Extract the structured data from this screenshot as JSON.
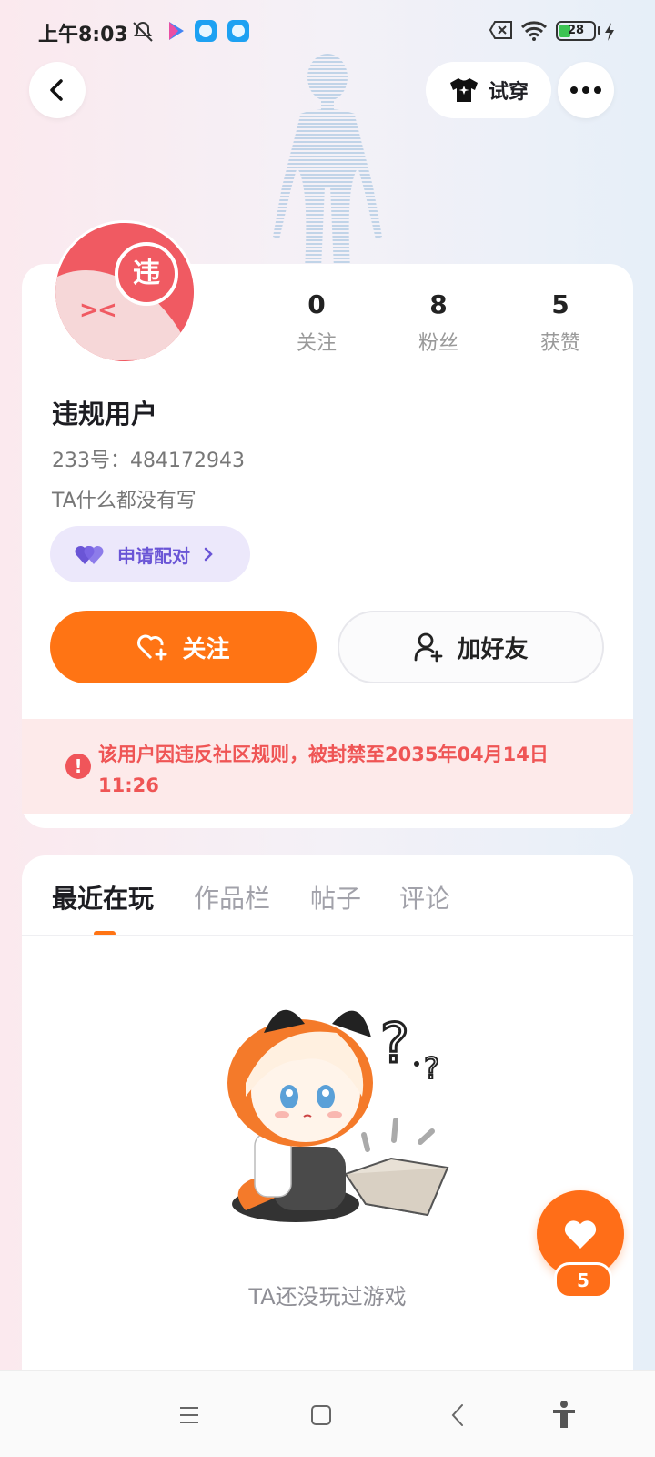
{
  "status_bar": {
    "time": "上午8:03",
    "battery": "28"
  },
  "header": {
    "try_on_label": "试穿"
  },
  "profile": {
    "avatar_badge": "违",
    "stats": [
      {
        "value": "0",
        "label": "关注"
      },
      {
        "value": "8",
        "label": "粉丝"
      },
      {
        "value": "5",
        "label": "获赞"
      }
    ],
    "username": "违规用户",
    "id_line": "233号：484172943",
    "bio": "TA什么都没有写",
    "match_label": "申请配对",
    "follow_label": "关注",
    "add_friend_label": "加好友",
    "ban_notice": "该用户因违反社区规则，被封禁至2035年04月14日 11:26"
  },
  "tabs": [
    {
      "label": "最近在玩",
      "active": true
    },
    {
      "label": "作品栏",
      "active": false
    },
    {
      "label": "帖子",
      "active": false
    },
    {
      "label": "评论",
      "active": false
    }
  ],
  "empty_state": {
    "text": "TA还没玩过游戏"
  },
  "like_fab": {
    "count": "5"
  },
  "colors": {
    "accent": "#ff7414",
    "ban_red": "#ef5555",
    "match_purple": "#6a55d6"
  },
  "icons": {
    "back": "chevron-left-icon",
    "try_on": "shirt-icon",
    "more": "more-dots-icon",
    "match": "double-heart-icon",
    "follow": "heart-plus-icon",
    "add_friend": "person-plus-icon",
    "ban": "alert-icon",
    "like": "heart-icon",
    "nav_menu": "menu-icon",
    "nav_home": "square-icon",
    "nav_back": "back-triangle-icon",
    "nav_accessibility": "accessibility-icon"
  }
}
